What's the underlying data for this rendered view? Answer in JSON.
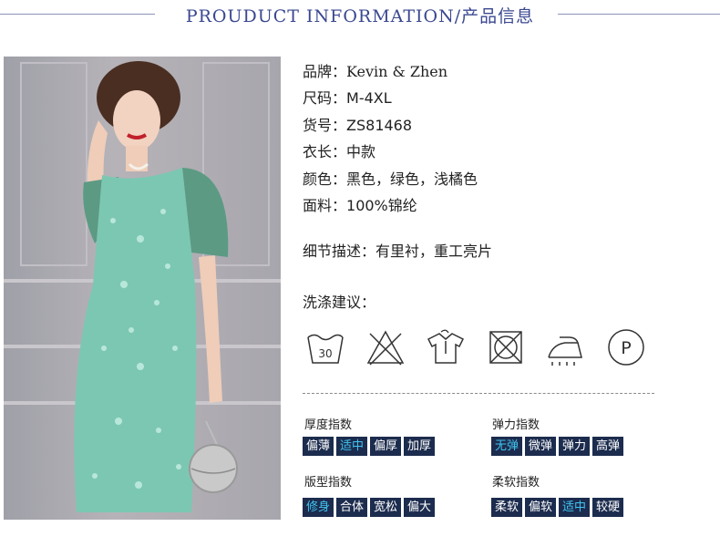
{
  "header": {
    "title": "PROUDUCT INFORMATION/产品信息"
  },
  "product_info": [
    {
      "key": "品牌：",
      "value": "Kevin & Zhen"
    },
    {
      "key": "尺码：",
      "value": "M-4XL"
    },
    {
      "key": "货号：",
      "value": "ZS81468"
    },
    {
      "key": "衣长：",
      "value": "中款"
    },
    {
      "key": "颜色：",
      "value": "黑色，绿色，浅橘色"
    },
    {
      "key": "面料：",
      "value": "100%锦纶"
    }
  ],
  "detail": {
    "key": "细节描述：",
    "value": "有里衬，重工亮片"
  },
  "care": {
    "title": "洗涤建议：",
    "wash_temp": "30",
    "icons": [
      "wash-30-icon",
      "no-bleach-icon",
      "hang-dry-icon",
      "no-tumble-dry-icon",
      "iron-low-icon",
      "dry-clean-p-icon"
    ],
    "dry_clean_letter": "P"
  },
  "indices": [
    {
      "title": "厚度指数",
      "options": [
        "偏薄",
        "适中",
        "偏厚",
        "加厚"
      ],
      "selected": 1
    },
    {
      "title": "弹力指数",
      "options": [
        "无弹",
        "微弹",
        "弹力",
        "高弹"
      ],
      "selected": 0
    },
    {
      "title": "版型指数",
      "options": [
        "修身",
        "合体",
        "宽松",
        "偏大"
      ],
      "selected": 0
    },
    {
      "title": "柔软指数",
      "options": [
        "柔软",
        "偏软",
        "适中",
        "较硬"
      ],
      "selected": 2
    }
  ],
  "colors": {
    "chip_bg": "#1c2c4e",
    "chip_text": "#ffffff",
    "chip_selected_text": "#40c4f0",
    "header_text": "#3a4790",
    "dress_green": "#7cc7b2"
  }
}
